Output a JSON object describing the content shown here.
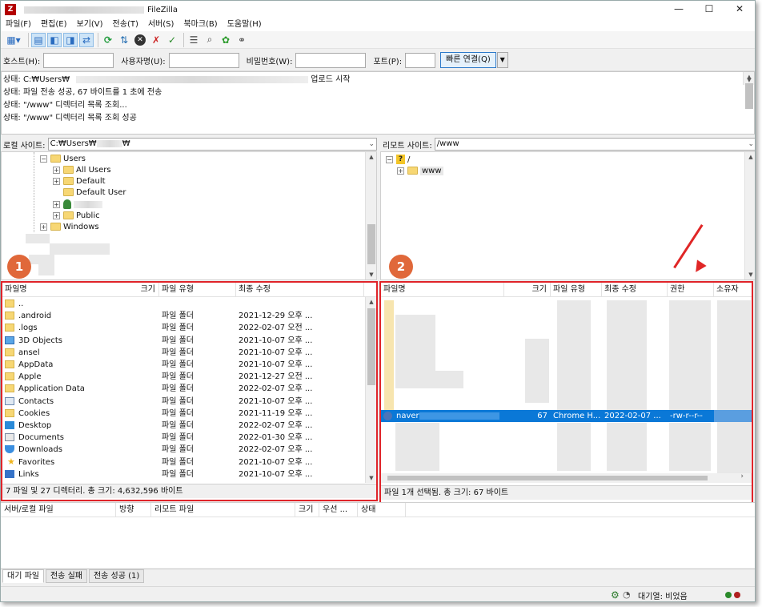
{
  "window": {
    "app_name": "FileZilla",
    "minimize": "—",
    "maximize": "☐",
    "close": "✕"
  },
  "menu": [
    "파일(F)",
    "편집(E)",
    "보기(V)",
    "전송(T)",
    "서버(S)",
    "북마크(B)",
    "도움말(H)"
  ],
  "quickconnect": {
    "host_label": "호스트(H):",
    "user_label": "사용자명(U):",
    "pass_label": "비밀번호(W):",
    "port_label": "포트(P):",
    "host_value": "",
    "user_value": "",
    "pass_value": "",
    "port_value": "",
    "connect_button": "빠른 연결(Q)"
  },
  "log": [
    {
      "prefix": "상태:",
      "text": "C:₩Users₩",
      "suffix": "업로드 시작"
    },
    {
      "prefix": "상태:",
      "text": "파일 전송 성공, 67 바이트를 1 초에 전송",
      "suffix": ""
    },
    {
      "prefix": "상태:",
      "text": "\"/www\" 디렉터리 목록 조회...",
      "suffix": ""
    },
    {
      "prefix": "상태:",
      "text": "\"/www\" 디렉터리 목록 조회 성공",
      "suffix": ""
    }
  ],
  "local": {
    "site_label": "로컬 사이트:",
    "site_path": "C:₩Users₩",
    "site_path_tail": "₩",
    "tree": [
      "Users",
      "All Users",
      "Default",
      "Default User",
      "",
      "Public",
      "Windows"
    ],
    "badge": "1",
    "headers": [
      "파일명",
      "크기",
      "파일 유형",
      "최종 수정"
    ],
    "rows": [
      {
        "name": "..",
        "type": "",
        "modified": "",
        "icon": "folder-icon"
      },
      {
        "name": ".android",
        "type": "파일 폴더",
        "modified": "2021-12-29 오후 ...",
        "icon": "folder-icon"
      },
      {
        "name": ".logs",
        "type": "파일 폴더",
        "modified": "2022-02-07 오전 ...",
        "icon": "folder-icon"
      },
      {
        "name": "3D Objects",
        "type": "파일 폴더",
        "modified": "2021-10-07 오후 ...",
        "icon": "3d-objects-icon"
      },
      {
        "name": "ansel",
        "type": "파일 폴더",
        "modified": "2021-10-07 오후 ...",
        "icon": "folder-icon"
      },
      {
        "name": "AppData",
        "type": "파일 폴더",
        "modified": "2021-10-07 오후 ...",
        "icon": "folder-icon"
      },
      {
        "name": "Apple",
        "type": "파일 폴더",
        "modified": "2021-12-27 오전 ...",
        "icon": "folder-icon"
      },
      {
        "name": "Application Data",
        "type": "파일 폴더",
        "modified": "2022-02-07 오후 ...",
        "icon": "folder-icon"
      },
      {
        "name": "Contacts",
        "type": "파일 폴더",
        "modified": "2021-10-07 오후 ...",
        "icon": "contacts-icon"
      },
      {
        "name": "Cookies",
        "type": "파일 폴더",
        "modified": "2021-11-19 오후 ...",
        "icon": "folder-icon"
      },
      {
        "name": "Desktop",
        "type": "파일 폴더",
        "modified": "2022-02-07 오후 ...",
        "icon": "desktop-icon"
      },
      {
        "name": "Documents",
        "type": "파일 폴더",
        "modified": "2022-01-30 오후 ...",
        "icon": "documents-icon"
      },
      {
        "name": "Downloads",
        "type": "파일 폴더",
        "modified": "2022-02-07 오후 ...",
        "icon": "downloads-icon"
      },
      {
        "name": "Favorites",
        "type": "파일 폴더",
        "modified": "2021-10-07 오후 ...",
        "icon": "star-icon"
      },
      {
        "name": "Links",
        "type": "파일 폴더",
        "modified": "2021-10-07 오후 ...",
        "icon": "links-icon"
      }
    ],
    "status": "7 파일 및 27 디렉터리. 총 크기: 4,632,596 바이트"
  },
  "remote": {
    "site_label": "리모트 사이트:",
    "site_path": "/www",
    "tree": [
      "/",
      "www"
    ],
    "badge": "2",
    "headers": [
      "파일명",
      "크기",
      "파일 유형",
      "최종 수정",
      "권한",
      "소유자"
    ],
    "selected_row": {
      "name": "naver",
      "size": "67",
      "type": "Chrome H...",
      "modified": "2022-02-07 ...",
      "perm": "-rw-r--r--"
    },
    "status": "파일 1개 선택됨. 총 크기: 67 바이트"
  },
  "queue": {
    "headers": [
      "서버/로컬 파일",
      "방향",
      "리모트 파일",
      "크기",
      "우선 ...",
      "상태"
    ],
    "tabs": [
      "대기 파일",
      "전송 실패",
      "전송 성공 (1)"
    ]
  },
  "statusbar": {
    "queue_text": "대기열: 비었음"
  }
}
